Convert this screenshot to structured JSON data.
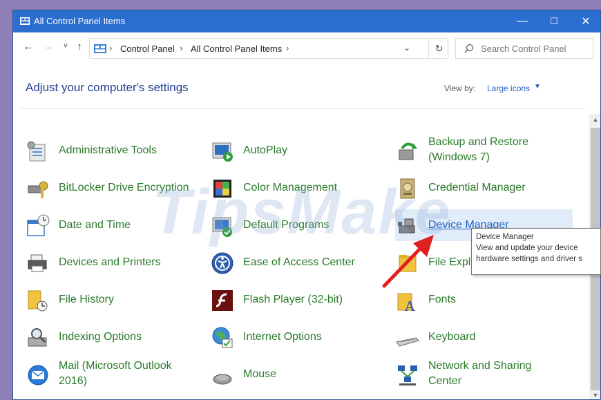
{
  "window": {
    "title": "All Control Panel Items",
    "minimize": "—",
    "maximize": "☐",
    "close": "✕"
  },
  "nav": {
    "back": "←",
    "forward": "→",
    "recent": "˅",
    "up": "↑"
  },
  "address": {
    "crumbs": [
      "Control Panel",
      "All Control Panel Items"
    ],
    "separator": "›",
    "dropdown": "⌄",
    "refresh": "↻"
  },
  "search": {
    "placeholder": "Search Control Panel"
  },
  "header": {
    "title": "Adjust your computer's settings",
    "view_by_label": "View by:",
    "view_by_value": "Large icons",
    "view_by_arrow": "▼"
  },
  "items": [
    {
      "label": "Administrative Tools",
      "icon": "admin-tools-icon"
    },
    {
      "label": "AutoPlay",
      "icon": "autoplay-icon"
    },
    {
      "label": "Backup and Restore (Windows 7)",
      "icon": "backup-icon"
    },
    {
      "label": "BitLocker Drive Encryption",
      "icon": "bitlocker-icon"
    },
    {
      "label": "Color Management",
      "icon": "color-management-icon"
    },
    {
      "label": "Credential Manager",
      "icon": "credential-icon"
    },
    {
      "label": "Date and Time",
      "icon": "date-time-icon"
    },
    {
      "label": "Default Programs",
      "icon": "default-programs-icon"
    },
    {
      "label": "Device Manager",
      "icon": "device-manager-icon"
    },
    {
      "label": "Devices and Printers",
      "icon": "printer-icon"
    },
    {
      "label": "Ease of Access Center",
      "icon": "ease-of-access-icon"
    },
    {
      "label": "File Explorer",
      "icon": "file-explorer-icon"
    },
    {
      "label": "File History",
      "icon": "file-history-icon"
    },
    {
      "label": "Flash Player (32-bit)",
      "icon": "flash-icon"
    },
    {
      "label": "Fonts",
      "icon": "fonts-icon"
    },
    {
      "label": "Indexing Options",
      "icon": "indexing-icon"
    },
    {
      "label": "Internet Options",
      "icon": "internet-options-icon"
    },
    {
      "label": "Keyboard",
      "icon": "keyboard-icon"
    },
    {
      "label": "Mail (Microsoft Outlook 2016)",
      "icon": "mail-icon"
    },
    {
      "label": "Mouse",
      "icon": "mouse-icon"
    },
    {
      "label": "Network and Sharing Center",
      "icon": "network-icon"
    }
  ],
  "tooltip": {
    "title": "Device Manager",
    "line1": "View and update your device",
    "line2": "hardware settings and driver s"
  },
  "watermark": "TipsMake",
  "colors": {
    "titlebar": "#2b6ed0",
    "link_green": "#2a7a2a",
    "header_blue": "#1e3d8f",
    "arrow_red": "#e02020"
  }
}
